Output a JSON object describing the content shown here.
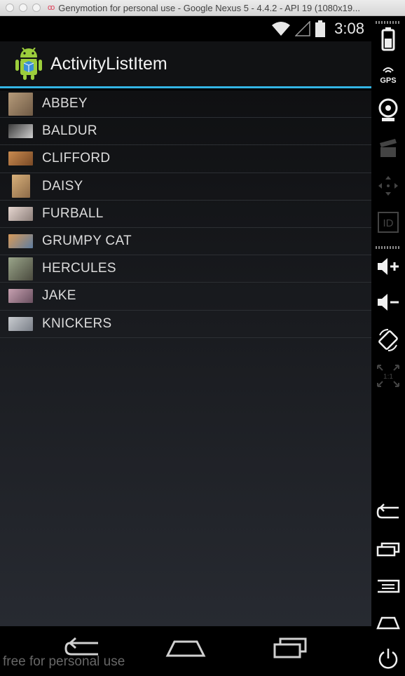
{
  "window": {
    "title": "Genymotion for personal use - Google Nexus 5 - 4.4.2 - API 19 (1080x19..."
  },
  "status_bar": {
    "time": "3:08",
    "icons": [
      "wifi-icon",
      "cell-signal-icon",
      "battery-icon"
    ]
  },
  "action_bar": {
    "title": "ActivityListItem",
    "accent_color": "#33b5e5"
  },
  "list": {
    "items": [
      {
        "label": "ABBEY",
        "thumb_colors": [
          "#b69b7a",
          "#6f5a45"
        ]
      },
      {
        "label": "BALDUR",
        "thumb_colors": [
          "#3b3b3b",
          "#cfcfcf"
        ]
      },
      {
        "label": "CLIFFORD",
        "thumb_colors": [
          "#c98a4f",
          "#7a4a26"
        ]
      },
      {
        "label": "DAISY",
        "thumb_colors": [
          "#d8b07a",
          "#8c6a48"
        ]
      },
      {
        "label": "FURBALL",
        "thumb_colors": [
          "#e6d6d0",
          "#8c7f7a"
        ]
      },
      {
        "label": "GRUMPY CAT",
        "thumb_colors": [
          "#d79a5a",
          "#5e7da0"
        ]
      },
      {
        "label": "HERCULES",
        "thumb_colors": [
          "#9aa58a",
          "#4a4a3e"
        ]
      },
      {
        "label": "JAKE",
        "thumb_colors": [
          "#c6a0b0",
          "#6a5060"
        ]
      },
      {
        "label": "KNICKERS",
        "thumb_colors": [
          "#c9ccd0",
          "#7a7f88"
        ]
      }
    ]
  },
  "nav_bar": {
    "buttons": [
      "back-icon",
      "home-icon",
      "recents-icon"
    ],
    "watermark": "free for personal use"
  },
  "sidebar": {
    "buttons": [
      "battery-icon",
      "gps-icon",
      "webcam-icon",
      "screencast-icon",
      "dpad-icon",
      "device-id-icon",
      "volume-up-icon",
      "volume-down-icon",
      "rotate-icon",
      "pixel-perfect-icon",
      "back-icon",
      "recents-icon",
      "menu-icon",
      "home-icon",
      "power-icon"
    ],
    "gps_label": "GPS",
    "id_label": "ID",
    "scale_label": "1:1"
  }
}
